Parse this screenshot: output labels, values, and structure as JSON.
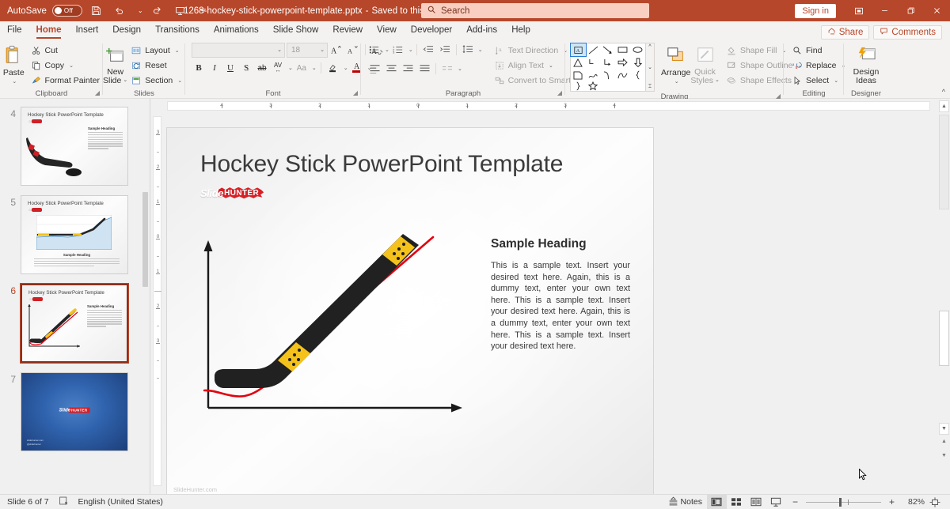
{
  "titlebar": {
    "autosave_label": "AutoSave",
    "autosave_state": "Off",
    "save_icon": "save-icon",
    "undo_icon": "undo-icon",
    "redo_icon": "redo-icon",
    "present_icon": "start-presentation-icon",
    "customize_icon": "customize-quick-access-icon",
    "filename": "1268-hockey-stick-powerpoint-template.pptx",
    "separator": "-",
    "saved_state": "Saved to this PC",
    "search_placeholder": "Search",
    "search_icon": "search-icon",
    "signin_label": "Sign in",
    "ribbon_display_icon": "ribbon-display-options-icon",
    "minimize_icon": "minimize-icon",
    "restore_icon": "restore-icon",
    "close_icon": "close-icon"
  },
  "tabs": [
    {
      "label": "File",
      "active": false
    },
    {
      "label": "Home",
      "active": true
    },
    {
      "label": "Insert",
      "active": false
    },
    {
      "label": "Design",
      "active": false
    },
    {
      "label": "Transitions",
      "active": false
    },
    {
      "label": "Animations",
      "active": false
    },
    {
      "label": "Slide Show",
      "active": false
    },
    {
      "label": "Review",
      "active": false
    },
    {
      "label": "View",
      "active": false
    },
    {
      "label": "Developer",
      "active": false
    },
    {
      "label": "Add-ins",
      "active": false
    },
    {
      "label": "Help",
      "active": false
    }
  ],
  "tab_right": {
    "share_label": "Share",
    "share_icon": "share-icon",
    "comments_label": "Comments",
    "comments_icon": "comment-icon"
  },
  "ribbon": {
    "clipboard": {
      "group_label": "Clipboard",
      "paste_label": "Paste",
      "cut_label": "Cut",
      "copy_label": "Copy",
      "format_painter_label": "Format Painter",
      "dialog_launcher": "dialog-box-launcher"
    },
    "slides": {
      "group_label": "Slides",
      "new_slide_label_1": "New",
      "new_slide_label_2": "Slide",
      "layout_label": "Layout",
      "reset_label": "Reset",
      "section_label": "Section"
    },
    "font": {
      "group_label": "Font",
      "font_name_value": "",
      "font_size_value": "18",
      "grow_font": "A",
      "shrink_font": "A",
      "clear_formatting": "A",
      "bold": "B",
      "italic": "I",
      "underline": "U",
      "shadow": "S",
      "strikethrough": "ab",
      "character_spacing": "AV",
      "change_case": "Aa",
      "text_highlight": "highlight-icon",
      "font_color": "A"
    },
    "paragraph": {
      "group_label": "Paragraph",
      "text_direction_label": "Text Direction",
      "align_text_label": "Align Text",
      "convert_smartart_label": "Convert to SmartArt"
    },
    "drawing": {
      "group_label": "Drawing",
      "arrange_label": "Arrange",
      "quick_styles_label_1": "Quick",
      "quick_styles_label_2": "Styles",
      "shape_fill_label": "Shape Fill",
      "shape_outline_label": "Shape Outline",
      "shape_effects_label": "Shape Effects"
    },
    "editing": {
      "group_label": "Editing",
      "find_label": "Find",
      "replace_label": "Replace",
      "select_label": "Select"
    },
    "designer": {
      "group_label": "Designer",
      "design_ideas_label_1": "Design",
      "design_ideas_label_2": "Ideas"
    },
    "collapse_icon": "collapse-ribbon-icon"
  },
  "thumbnails": [
    {
      "number": "4",
      "title": "Hockey Stick PowerPoint Template",
      "active": false,
      "variant": "stick-puck"
    },
    {
      "number": "5",
      "title": "Hockey Stick PowerPoint Template",
      "active": false,
      "variant": "area-chart"
    },
    {
      "number": "6",
      "title": "Hockey Stick PowerPoint Template",
      "active": true,
      "variant": "stick-curve"
    },
    {
      "number": "7",
      "title": "",
      "active": false,
      "variant": "blue-closing"
    }
  ],
  "rulers": {
    "horizontal_ticks": [
      "4",
      "3",
      "2",
      "1",
      "0",
      "1",
      "2",
      "3",
      "4"
    ],
    "vertical_ticks": [
      "3",
      "2",
      "1",
      "0",
      "1",
      "2",
      "3"
    ]
  },
  "slide": {
    "title": "Hockey Stick PowerPoint Template",
    "logo_part1": "Slide",
    "logo_part2": "HUNTER",
    "heading": "Sample Heading",
    "body": "This is a sample text. Insert your desired text here. Again, this is a dummy text, enter your own text here. This is a sample text. Insert your desired text here. Again, this is a dummy text, enter your own text here. This is a sample text. Insert your desired text here.",
    "footer": "SlideHunter.com",
    "colors": {
      "stick_black": "#1f1f1f",
      "stick_tape_yellow": "#f5c21b",
      "curve_red": "#e3000f",
      "axis_black": "#1a1a1a",
      "title_gray": "#3b3b3b",
      "logo_red": "#d81f26"
    }
  },
  "statusbar": {
    "slide_counter": "Slide 6 of 7",
    "accessibility_icon": "accessibility-checker-icon",
    "language": "English (United States)",
    "notes_label": "Notes",
    "notes_icon": "notes-icon",
    "view_normal_icon": "normal-view-icon",
    "view_sorter_icon": "slide-sorter-icon",
    "view_reading_icon": "reading-view-icon",
    "view_slideshow_icon": "slide-show-icon",
    "zoom_out_label": "−",
    "zoom_in_label": "+",
    "zoom_level": "82%",
    "fit_slide_icon": "fit-slide-to-window-icon"
  }
}
